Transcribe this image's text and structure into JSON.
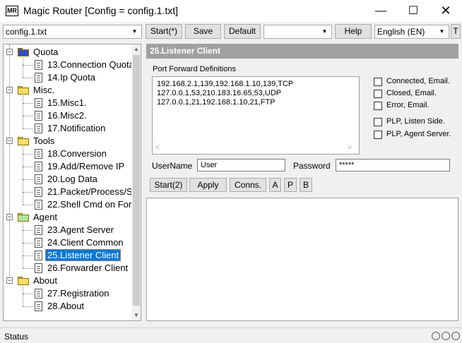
{
  "window": {
    "icon_text": "MR",
    "title": "Magic Router [Config = config.1.txt]",
    "minimize": "—",
    "maximize": "☐",
    "close": "✕"
  },
  "toolbar": {
    "config_value": "config.1.txt",
    "start_label": "Start(*)",
    "save_label": "Save",
    "default_label": "Default",
    "extra_combo_value": "",
    "help_label": "Help",
    "language_value": "English (EN)",
    "t_label": "T"
  },
  "tree": {
    "groups": [
      {
        "label": "Quota",
        "items": [
          "13.Connection Quota",
          "14.Ip Quota"
        ]
      },
      {
        "label": "Misc.",
        "items": [
          "15.Misc1.",
          "16.Misc2.",
          "17.Notification"
        ]
      },
      {
        "label": "Tools",
        "items": [
          "18.Conversion",
          "19.Add/Remove IP",
          "20.Log Data",
          "21.Packet/Process/S",
          "22.Shell Cmd on For"
        ]
      },
      {
        "label": "Agent",
        "items": [
          "23.Agent Server",
          "24.Client Common",
          "25.Listener Client",
          "26.Forwarder Client"
        ]
      },
      {
        "label": "About",
        "items": [
          "27.Registration",
          "28.About"
        ]
      }
    ],
    "selected": "25.Listener Client"
  },
  "panel": {
    "header": "25.Listener Client",
    "pfd_label": "Port Forward Definitions",
    "pfd_lines": [
      "192.168.2.1,139,192.168.1.10,139,TCP",
      "127.0.0.1,53,210.183.16.65,53,UDP",
      "127.0.0.1,21,192.168.1.10,21,FTP"
    ],
    "checkboxes": [
      "Connected, Email.",
      "Closed, Email.",
      "Error, Email.",
      "PLP, Listen Side.",
      "PLP, Agent Server."
    ],
    "username_label": "UserName",
    "username_value": "User",
    "password_label": "Password",
    "password_value": "*****",
    "buttons": {
      "start": "Start(2)",
      "apply": "Apply",
      "conns": "Conns.",
      "a": "A",
      "p": "P",
      "b": "B"
    }
  },
  "status": {
    "text": "Status"
  }
}
